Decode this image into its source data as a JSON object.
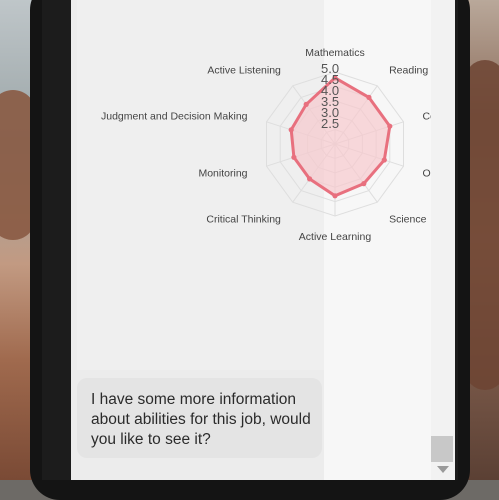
{
  "chat": {
    "message": "I have some more information about abilities for this job, would you like to see it?"
  },
  "chart_data": {
    "type": "radar",
    "axes": [
      "Mathematics",
      "Reading",
      "Co",
      "Op",
      "Science",
      "Active Learning",
      "Critical Thinking",
      "Monitoring",
      "Judgment and Decision Making",
      "Active Listening"
    ],
    "values": [
      4.8,
      4.5,
      4.5,
      4.3,
      4.2,
      4.3,
      4.0,
      4.0,
      4.1,
      4.2
    ],
    "radial_ticks": [
      "5.0",
      "4.5",
      "4.0",
      "3.5",
      "3.0",
      "2.5"
    ],
    "rmin": 2.5,
    "rmax": 5.0,
    "series_color": "#e8707e",
    "fill_color": "#f7c9cd"
  }
}
